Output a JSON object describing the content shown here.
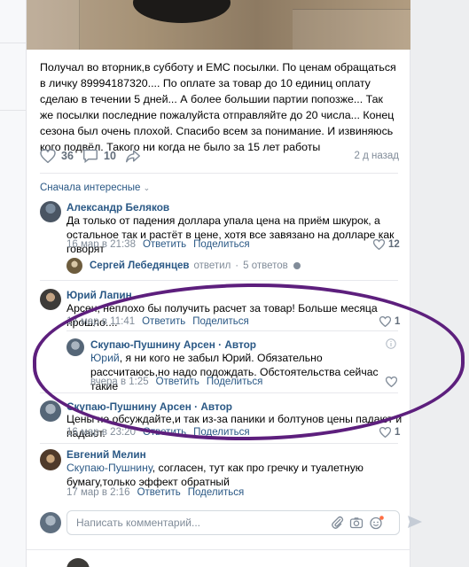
{
  "post": {
    "text": "Получал во вторник,в субботу и ЕМС посылки. По ценам обращаться в личку 89994187320.... По оплате за товар до 10 единиц оплату сделаю в течении 5 дней... А более большии партии попозже... Так же посылки последние пожалуйста отправляйте до 20 числа... Конец сезона был очень плохой. Спасибо всем за понимание. И извиняюсь кого подвёл. Такого ни когда не было за 15 лет работы",
    "likes": "36",
    "comments": "10",
    "time": "2 д назад"
  },
  "sort_label": "Сначала интересные",
  "comments": [
    {
      "name": "Александр Беляков",
      "text": "Да только от падения доллара упала цена на приём шкурок, а остальное так и растёт в цене, хотя все завязано на долларе как говорят",
      "date": "16 мар в 21:38",
      "reply": "Ответить",
      "share": "Поделиться",
      "likes": "12",
      "answers": {
        "name": "Сергей Лебедянцев",
        "action": "ответил",
        "count": "5 ответов"
      }
    },
    {
      "name": "Юрий Лапин",
      "text": "Арсен, неплохо бы получить расчет за товар! Больше месяца прошло....",
      "date": "17 мар в 11:41",
      "reply": "Ответить",
      "share": "Поделиться",
      "likes": "1",
      "reply_comment": {
        "name": "Скупаю-Пушнину Арсен · Автор",
        "mention": "Юрий",
        "text": ", я ни кого не забыл Юрий. Обязательно рассчитаюсь,но надо подождать. Обстоятельства сейчас такие",
        "date": "вчера в 1:25",
        "reply": "Ответить",
        "share": "Поделиться"
      }
    },
    {
      "name": "Скупаю-Пушнину Арсен · Автор",
      "text": "Цены не обсуждайте,и так из-за паники и болтунов цены падают и падают.",
      "date": "16 мар в 23:20",
      "reply": "Ответить",
      "share": "Поделиться",
      "likes": "1"
    },
    {
      "name": "Евгений Мелин",
      "mention": "Скупаю-Пушнину",
      "text": ", согласен, тут как про гречку и туалетную бумагу,только эффект обратный",
      "date": "17 мар в 2:16",
      "reply": "Ответить",
      "share": "Поделиться"
    }
  ],
  "compose_placeholder": "Написать комментарий...",
  "colors": {
    "link": "#2a5885",
    "muted": "#818c99",
    "annotation": "#5d1f7d"
  }
}
